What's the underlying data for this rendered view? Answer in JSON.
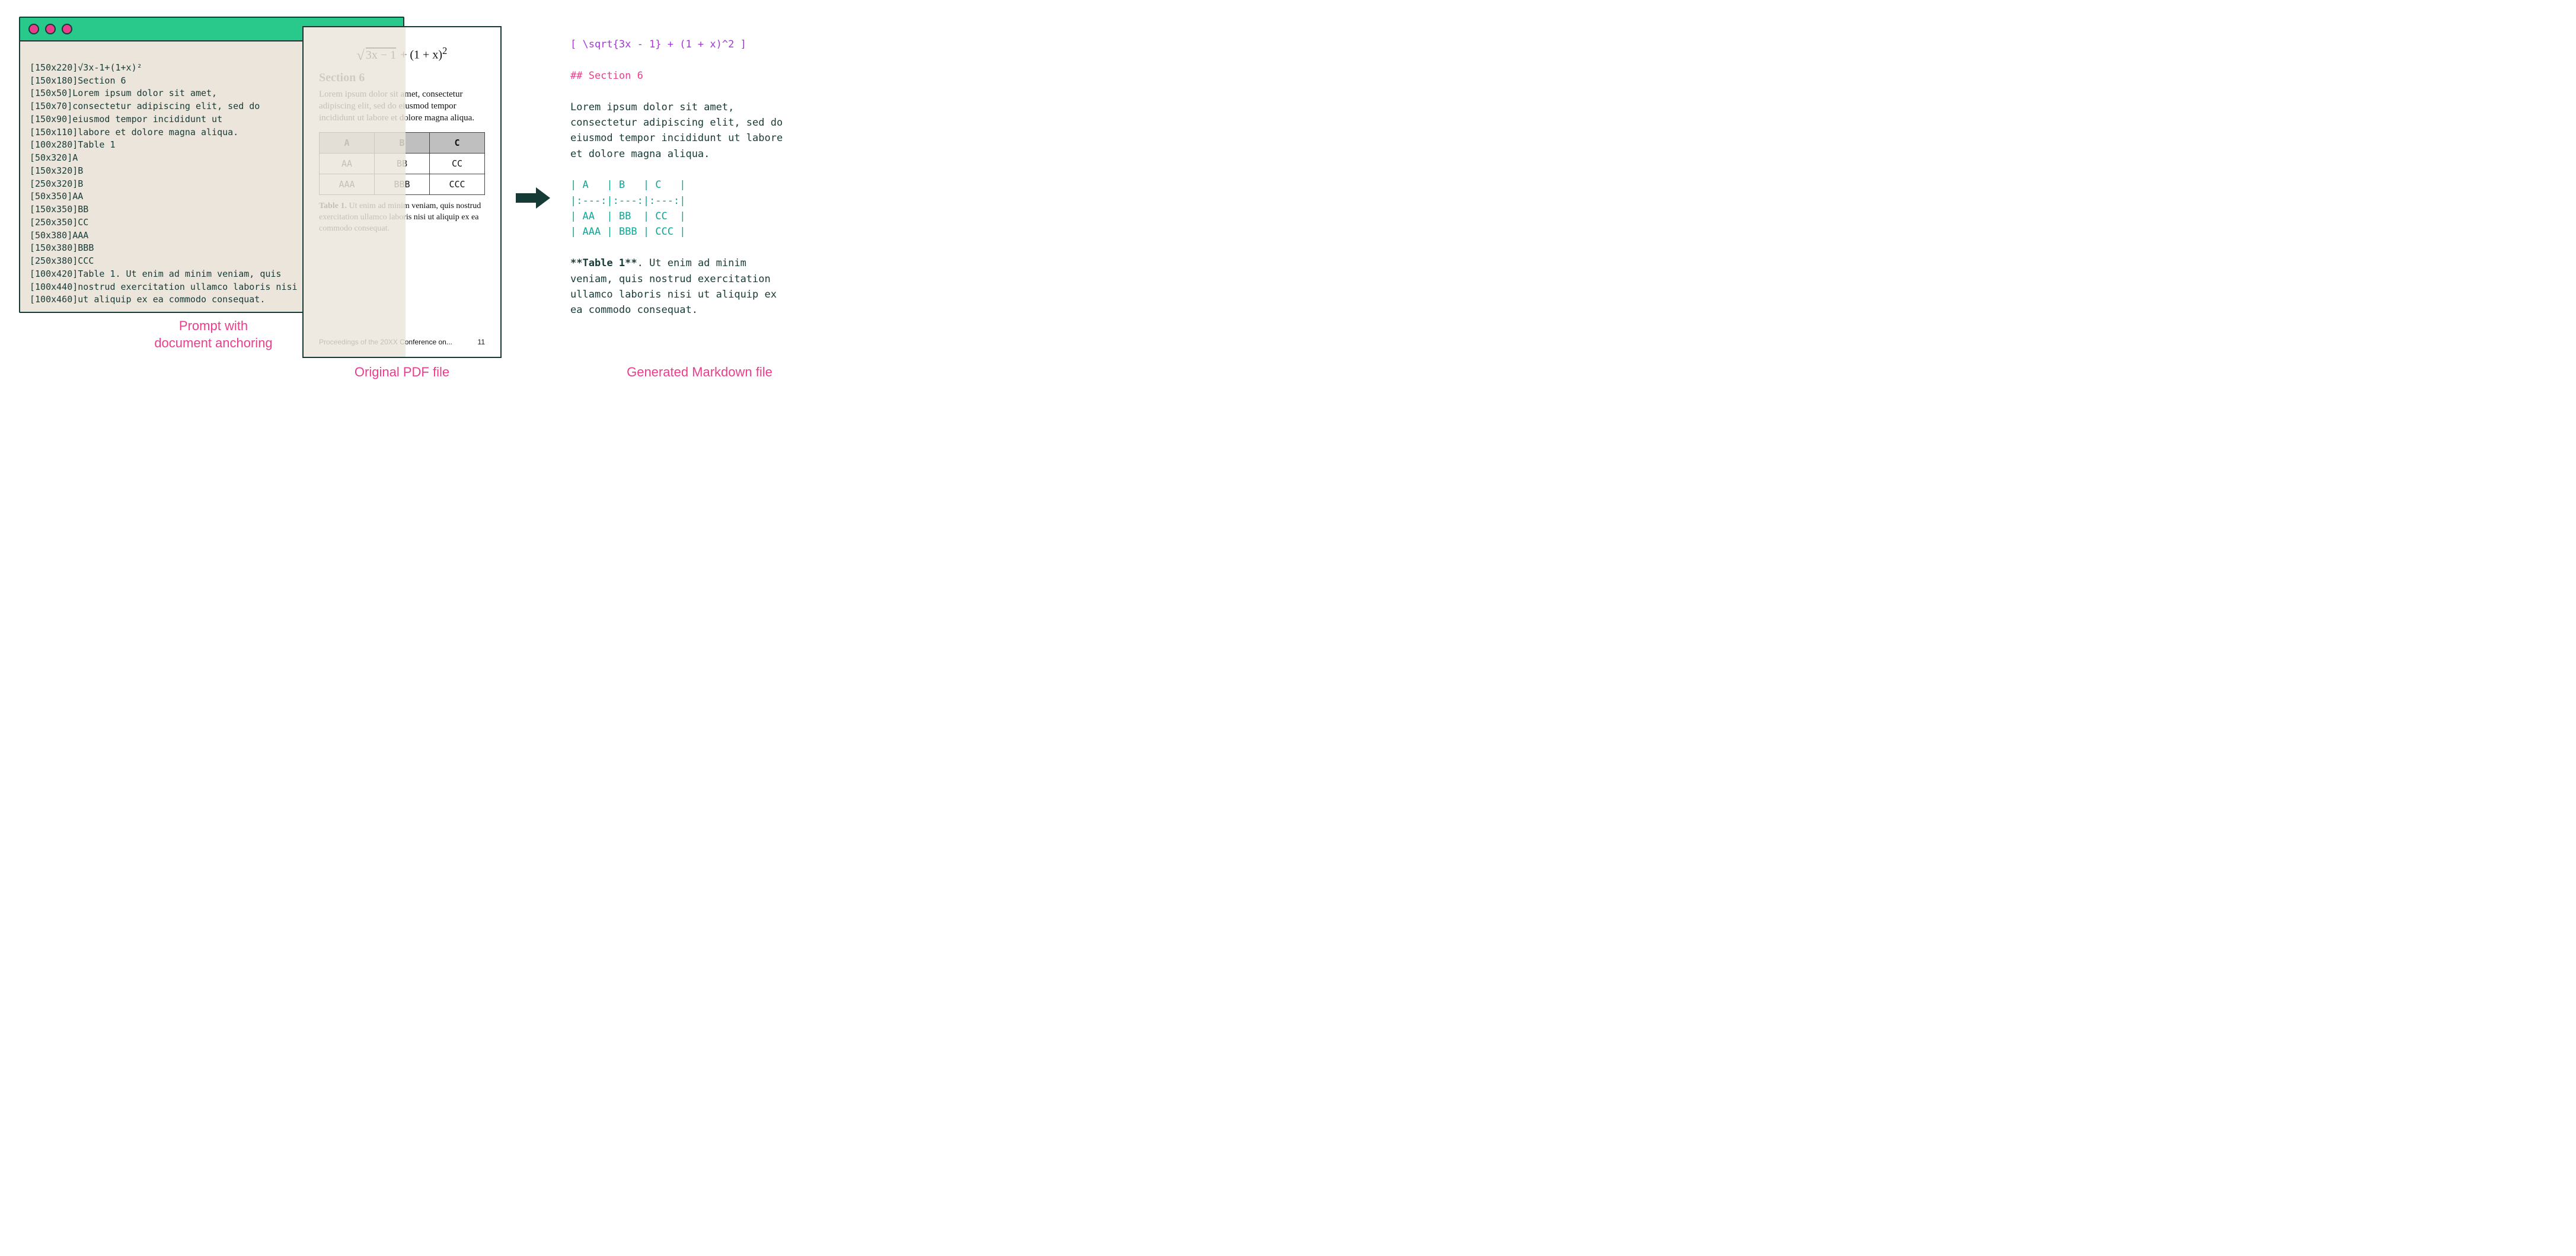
{
  "terminal": {
    "lines": [
      "[150x220]√3x-1+(1+x)²",
      "[150x180]Section 6",
      "[150x50]Lorem ipsum dolor sit amet,",
      "[150x70]consectetur adipiscing elit, sed do",
      "[150x90]eiusmod tempor incididunt ut",
      "[150x110]labore et dolore magna aliqua.",
      "[100x280]Table 1",
      "[50x320]A",
      "[150x320]B",
      "[250x320]B",
      "[50x350]AA",
      "[150x350]BB",
      "[250x350]CC",
      "[50x380]AAA",
      "[150x380]BBB",
      "[250x380]CCC",
      "[100x420]Table 1. Ut enim ad minim veniam, quis",
      "[100x440]nostrud exercitation ullamco laboris nisi",
      "[100x460]ut aliquip ex ea commodo consequat."
    ]
  },
  "pdf": {
    "formula_sqrt_inner": "3x − 1",
    "formula_rest": " + (1 + x)",
    "formula_exp": "2",
    "heading": "Section 6",
    "body": "Lorem ipsum dolor sit amet, consectetur adipiscing elit, sed do eiusmod tempor incididunt ut labore et dolore magna aliqua.",
    "table": {
      "head": [
        "A",
        "B",
        "C"
      ],
      "rows": [
        [
          "AA",
          "BB",
          "CC"
        ],
        [
          "AAA",
          "BBB",
          "CCC"
        ]
      ]
    },
    "caption_bold": "Table 1.",
    "caption_rest": " Ut enim ad minim veniam, quis nostrud exercitation ullamco laboris nisi ut aliquip ex ea commodo consequat.",
    "footer_left": "Proceedings of the 20XX Conference on...",
    "footer_right": "11"
  },
  "markdown": {
    "math": "[ \\sqrt{3x - 1} + (1 + x)^2 ]",
    "heading": "## Section 6",
    "para1": "Lorem ipsum dolor sit amet,",
    "para2": "consectetur adipiscing elit, sed do",
    "para3": "eiusmod tempor incididunt ut labore",
    "para4": "et dolore magna aliqua.",
    "tbl1": "| A   | B   | C   |",
    "tbl2": "|:---:|:---:|:---:|",
    "tbl3": "| AA  | BB  | CC  |",
    "tbl4": "| AAA | BBB | CCC |",
    "cap_bold": "**Table 1**",
    "cap_rest1": ". Ut enim ad minim",
    "cap_line2": "veniam, quis nostrud exercitation",
    "cap_line3": "ullamco laboris nisi ut aliquip ex",
    "cap_line4": "ea commodo consequat."
  },
  "captions": {
    "prompt_l1": "Prompt with",
    "prompt_l2": "document anchoring",
    "pdf": "Original PDF file",
    "md": "Generated Markdown file"
  }
}
